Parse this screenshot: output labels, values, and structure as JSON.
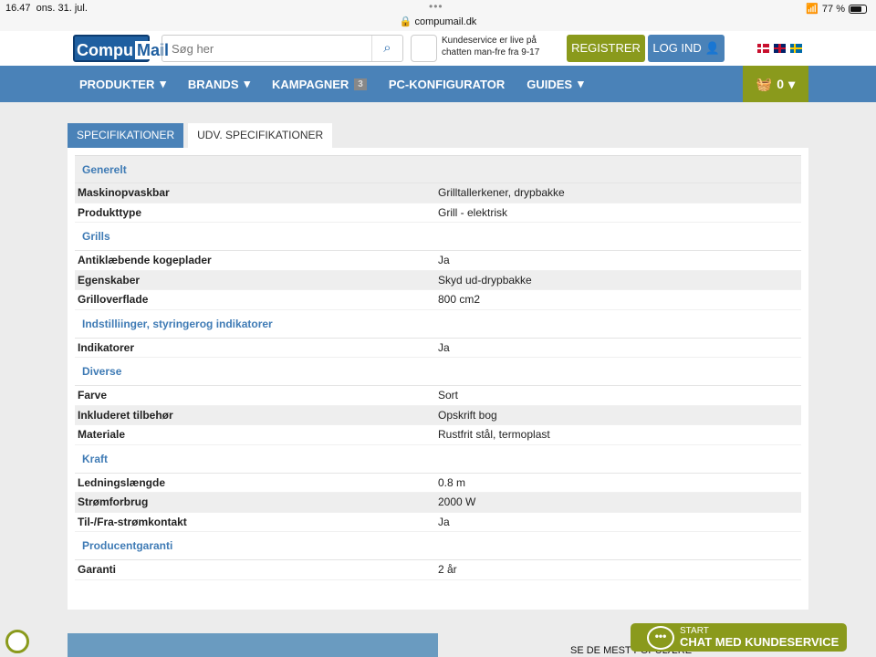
{
  "status": {
    "time": "16.47",
    "date": "ons. 31. jul.",
    "url": "compumail.dk",
    "battery": "77 %"
  },
  "header": {
    "logo": "CompuMail",
    "logo_a": "Compu",
    "logo_b": "Mail",
    "search_placeholder": "Søg her",
    "cs_line1": "Kundeservice er live på",
    "cs_line2": "chatten man-fre fra 9-17",
    "register": "REGISTRER",
    "login": "LOG IND"
  },
  "nav": {
    "items": [
      "PRODUKTER",
      "BRANDS",
      "KAMPAGNER",
      "PC-KONFIGURATOR",
      "GUIDES"
    ],
    "kampagner_badge": "3",
    "cart_count": "0"
  },
  "tabs": [
    "SPECIFIKATIONER",
    "UDV. SPECIFIKATIONER"
  ],
  "sections": [
    {
      "title": "Generelt",
      "rows": [
        [
          "Maskinopvaskbar",
          "Grilltallerkener, drypbakke"
        ],
        [
          "Produkttype",
          "Grill - elektrisk"
        ]
      ]
    },
    {
      "title": "Grills",
      "rows": [
        [
          "Antiklæbende kogeplader",
          "Ja"
        ],
        [
          "Egenskaber",
          "Skyd ud-drypbakke"
        ],
        [
          "Grilloverflade",
          "800 cm2"
        ]
      ]
    },
    {
      "title": "Indstilliinger, styringerog indikatorer",
      "rows": [
        [
          "Indikatorer",
          "Ja"
        ]
      ]
    },
    {
      "title": "Diverse",
      "rows": [
        [
          "Farve",
          "Sort"
        ],
        [
          "Inkluderet tilbehør",
          "Opskrift bog"
        ],
        [
          "Materiale",
          "Rustfrit stål, termoplast"
        ]
      ]
    },
    {
      "title": "Kraft",
      "rows": [
        [
          "Ledningslængde",
          "0.8 m"
        ],
        [
          "Strømforbrug",
          "2000 W"
        ],
        [
          "Til-/Fra-strømkontakt",
          "Ja"
        ]
      ]
    },
    {
      "title": "Producentgaranti",
      "rows": [
        [
          "Garanti",
          "2 år"
        ]
      ]
    }
  ],
  "footer": {
    "popular": "SE DE MEST POPULÆRE",
    "chat_small": "START",
    "chat_big": "CHAT MED KUNDESERVICE"
  }
}
